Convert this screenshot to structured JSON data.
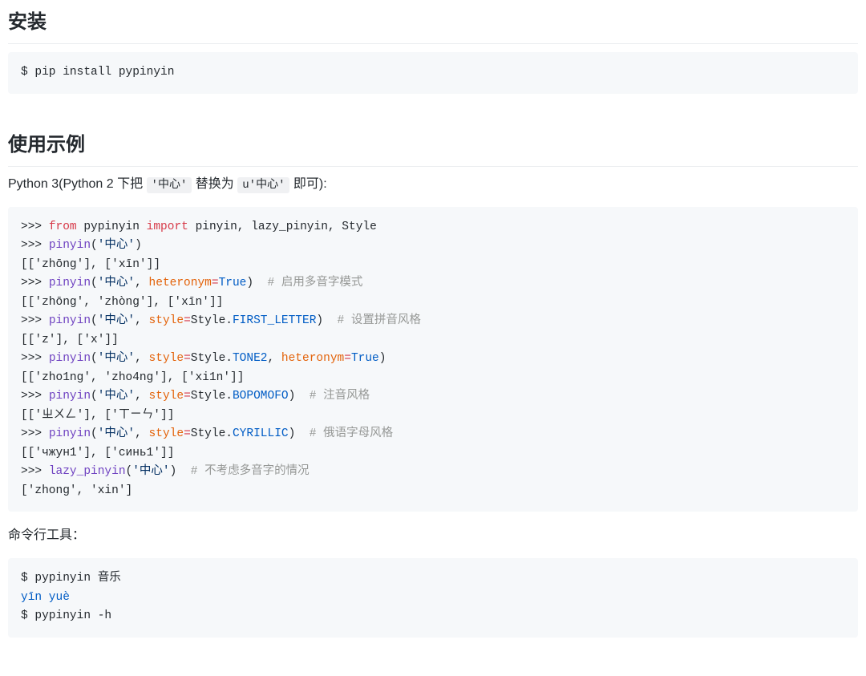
{
  "headings": {
    "install": "安装",
    "usage": "使用示例"
  },
  "code_install_line1": "$ pip install pypinyin",
  "usage_intro": {
    "before1": "Python 3(Python 2 下把 ",
    "inline1": "'中心'",
    "mid": " 替换为 ",
    "inline2": "u'中心'",
    "after": " 即可):"
  },
  "cli_intro": "命令行工具：",
  "tok": {
    "prompt": ">>>",
    "from": "from",
    "import": "import",
    "mod": "pypinyin",
    "names": "pinyin, lazy_pinyin, Style",
    "pinyin": "pinyin",
    "lazy_pinyin": "lazy_pinyin",
    "lp": "(",
    "rp": ")",
    "comma_sp": ", ",
    "s_zhongxin": "'中心'",
    "heteronym": "heteronym",
    "eq": "=",
    "true": "True",
    "style": "style",
    "styleObj": "Style",
    "dot": ".",
    "FIRST_LETTER": "FIRST_LETTER",
    "TONE2": "TONE2",
    "BOPOMOFO": "BOPOMOFO",
    "CYRILLIC": "CYRILLIC",
    "c_heteronym": "# 启用多音字模式",
    "c_style": "# 设置拼音风格",
    "c_bpmf": "# 注音风格",
    "c_cyr": "# 俄语字母风格",
    "c_lazy": "# 不考虑多音字的情况",
    "out1": "[['zhōng'], ['xīn']]",
    "out2": "[['zhōng', 'zhòng'], ['xīn']]",
    "out3": "[['z'], ['x']]",
    "out4": "[['zho1ng', 'zho4ng'], ['xi1n']]",
    "out5": "[['ㄓㄨㄥ'], ['ㄒㄧㄣ']]",
    "out6": "[['чжун1'], ['синь1']]",
    "out7": "['zhong', 'xin']"
  },
  "cli": {
    "l1": "$ pypinyin 音乐",
    "l2": "yīn yuè",
    "l3": "$ pypinyin -h"
  }
}
